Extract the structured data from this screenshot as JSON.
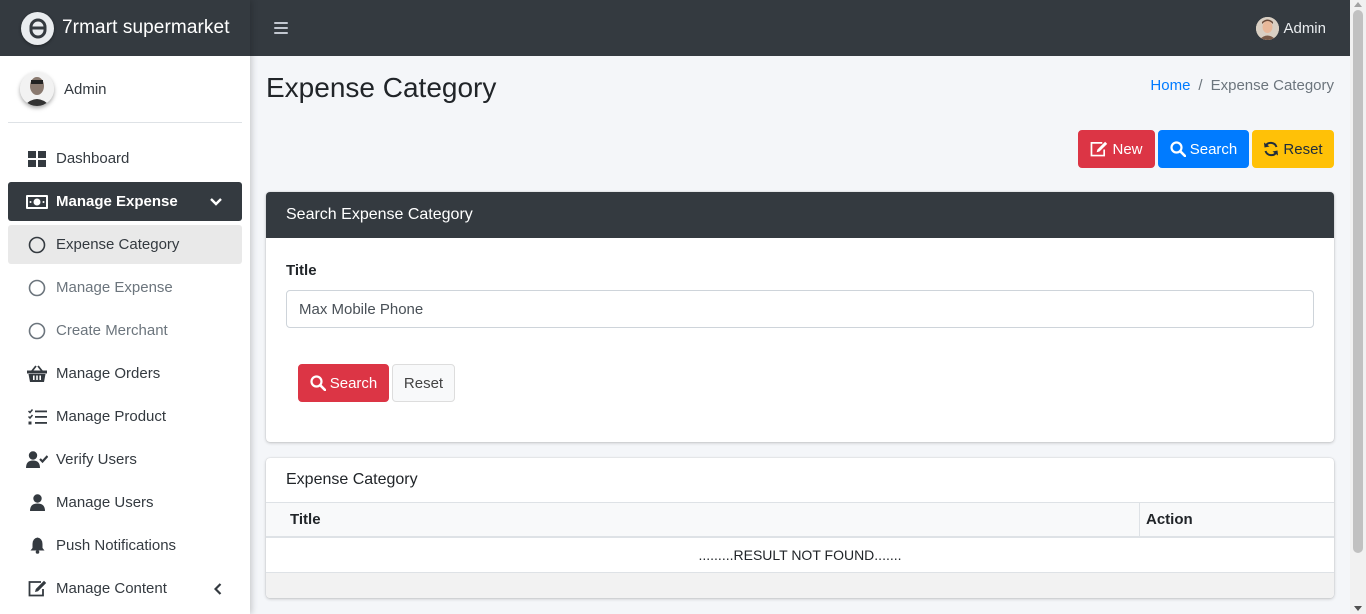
{
  "brand": {
    "name": "7rmart supermarket"
  },
  "sidebar": {
    "user_name": "Admin",
    "items": [
      {
        "label": "Dashboard",
        "icon": "dashboard-icon"
      },
      {
        "label": "Manage Expense",
        "icon": "money-bill-icon"
      },
      {
        "label": "Expense Category",
        "icon": "circle-icon"
      },
      {
        "label": "Manage Expense",
        "icon": "circle-icon"
      },
      {
        "label": "Create Merchant",
        "icon": "circle-icon"
      },
      {
        "label": "Manage Orders",
        "icon": "basket-icon"
      },
      {
        "label": "Manage Product",
        "icon": "tasks-icon"
      },
      {
        "label": "Verify Users",
        "icon": "user-check-icon"
      },
      {
        "label": "Manage Users",
        "icon": "user-icon"
      },
      {
        "label": "Push Notifications",
        "icon": "bell-icon"
      },
      {
        "label": "Manage Content",
        "icon": "edit-icon"
      }
    ]
  },
  "topbar": {
    "user_name": "Admin"
  },
  "page": {
    "title": "Expense Category",
    "breadcrumb": {
      "home": "Home",
      "separator": "/",
      "current": "Expense Category"
    }
  },
  "actions": {
    "new_label": "New",
    "search_label": "Search",
    "reset_label": "Reset"
  },
  "search_card": {
    "title": "Search Expense Category",
    "field_label": "Title",
    "field_value": "Max Mobile Phone",
    "search_label": "Search",
    "reset_label": "Reset"
  },
  "results_card": {
    "title": "Expense Category",
    "columns": [
      "Title",
      "Action"
    ],
    "empty_message": ".........RESULT NOT FOUND......."
  },
  "colors": {
    "dark": "#343a40",
    "danger": "#dc3545",
    "primary": "#007bff",
    "warning": "#ffc107",
    "link": "#007bff"
  }
}
